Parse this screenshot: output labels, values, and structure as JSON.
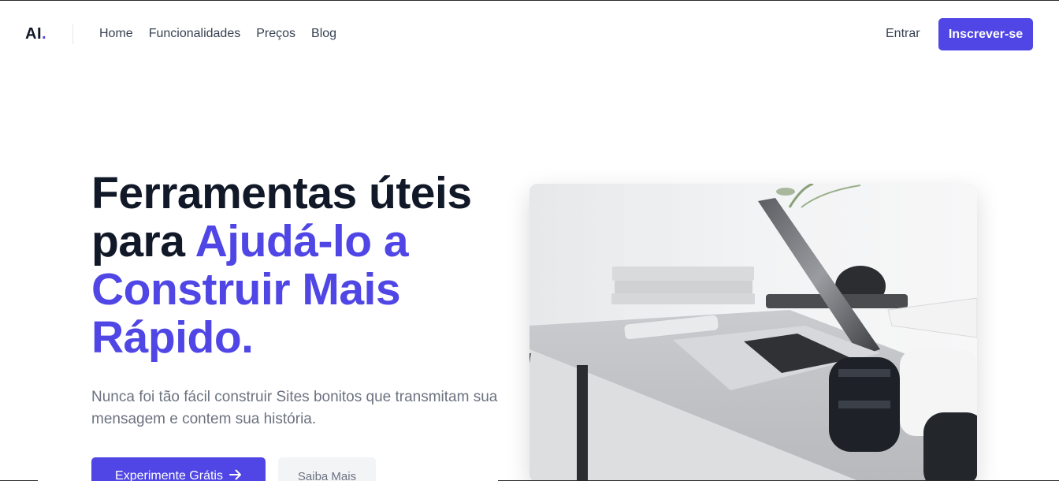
{
  "nav": {
    "logo_text": "AI",
    "logo_dot": ".",
    "links": [
      "Home",
      "Funcionalidades",
      "Preços",
      "Blog"
    ],
    "login_label": "Entrar",
    "signup_label": "Inscrever-se"
  },
  "hero": {
    "headline_plain": "Ferramentas úteis para ",
    "headline_accent": "Ajudá-lo a Construir Mais Rápido.",
    "subtitle": "Nunca foi tão fácil construir Sites bonitos que transmitam sua mensagem e contem sua história.",
    "primary_button": "Experimente Grátis",
    "secondary_button": "Saiba Mais"
  },
  "colors": {
    "accent": "#4f46e5",
    "heading": "#111827",
    "body_text": "#6b7280"
  },
  "icons": {
    "arrow": "arrow-right-icon"
  }
}
